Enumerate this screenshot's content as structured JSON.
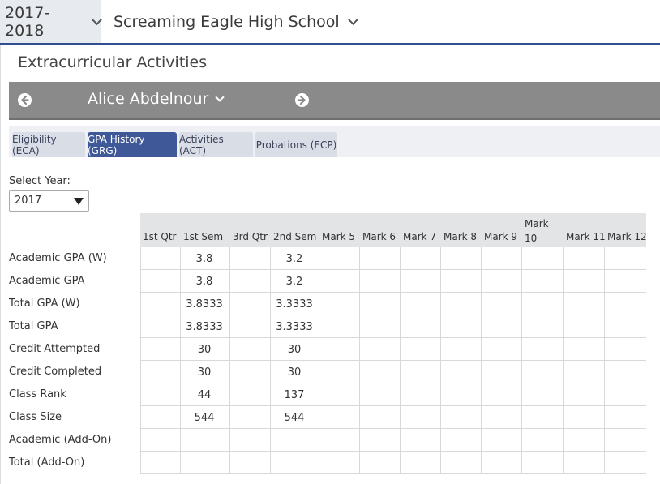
{
  "header": {
    "year": "2017-2018",
    "school": "Screaming Eagle High School"
  },
  "page": {
    "title": "Extracurricular Activities"
  },
  "student": {
    "name": "Alice Abdelnour"
  },
  "tabs": [
    "Eligibility (ECA)",
    "GPA History (GRG)",
    "Activities (ACT)",
    "Probations (ECP)"
  ],
  "active_tab": "GPA History (GRG)",
  "filter": {
    "label": "Select Year:",
    "value": "2017"
  },
  "table": {
    "columns": [
      "1st Qtr",
      "1st Sem",
      "3rd Qtr",
      "2nd Sem",
      "Mark 5",
      "Mark 6",
      "Mark 7",
      "Mark 8",
      "Mark 9",
      "Mark 10",
      "Mark 11",
      "Mark 12"
    ],
    "rows": [
      {
        "label": "Academic GPA (W)",
        "sem1": "3.8",
        "sem2": "3.2"
      },
      {
        "label": "Academic GPA",
        "sem1": "3.8",
        "sem2": "3.2"
      },
      {
        "label": "Total GPA (W)",
        "sem1": "3.8333",
        "sem2": "3.3333"
      },
      {
        "label": "Total GPA",
        "sem1": "3.8333",
        "sem2": "3.3333"
      },
      {
        "label": "Credit Attempted",
        "sem1": "30",
        "sem2": "30"
      },
      {
        "label": "Credit Completed",
        "sem1": "30",
        "sem2": "30"
      },
      {
        "label": "Class Rank",
        "sem1": "44",
        "sem2": "137"
      },
      {
        "label": "Class Size",
        "sem1": "544",
        "sem2": "544"
      },
      {
        "label": "Academic (Add-On)",
        "sem1": "",
        "sem2": ""
      },
      {
        "label": "Total (Add-On)",
        "sem1": "",
        "sem2": ""
      }
    ]
  },
  "icons": {
    "prev": "arrow-left-circle-icon",
    "next": "arrow-right-circle-icon",
    "dropdown": "chevron-down-icon"
  },
  "colors": {
    "accent": "#3f5998",
    "bar": "#8a8a8a"
  }
}
